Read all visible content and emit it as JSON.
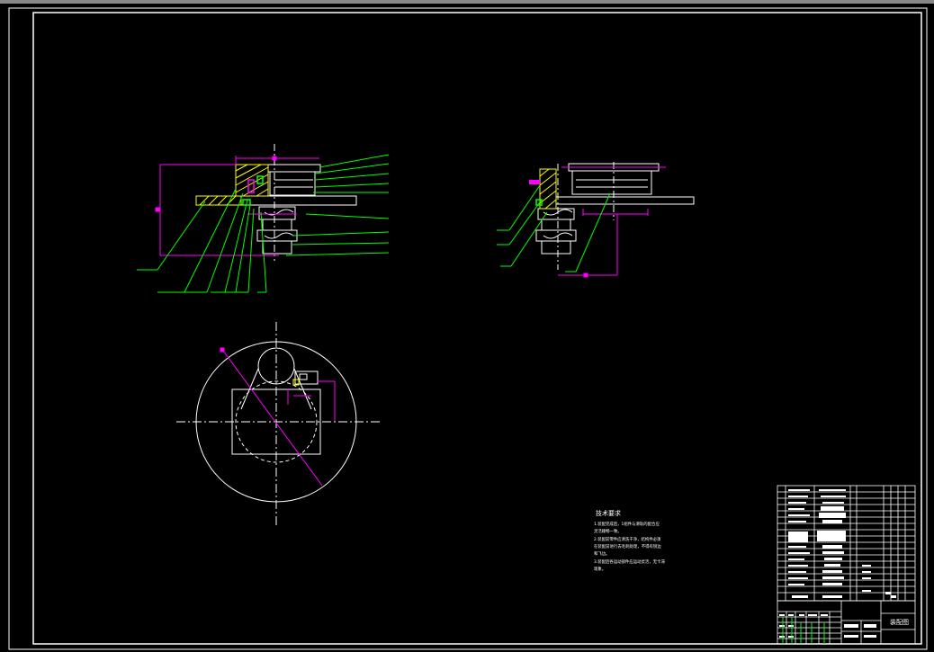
{
  "colors": {
    "background": "#000000",
    "line": "#ffffff",
    "leader": "#00ff00",
    "dimension": "#ff00ff",
    "hatch": "#ffff00",
    "cyan": "#00ffff"
  },
  "tech_notes": {
    "title": "技术要求",
    "lines": [
      "1.装配完成后，1组件与滑轨的配合应",
      "  灵活顺畅一致。",
      "2.装配前零件应清洗干净，结构件必须",
      "  在装配前进行去毛刺处理，不得有锐边",
      "  和飞边。",
      "3.装配后各运动部件应运动灵活，无卡滞",
      "  现象。"
    ]
  },
  "title_block": {
    "drawing_name": "装配图"
  }
}
